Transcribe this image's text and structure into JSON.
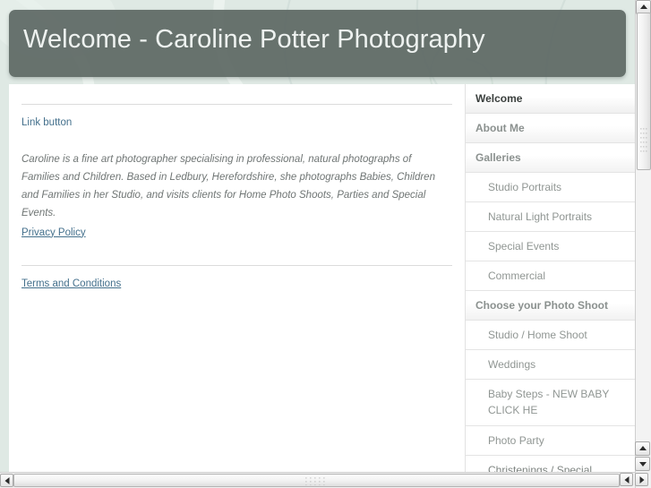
{
  "header": {
    "title": "Welcome - Caroline Potter Photography"
  },
  "content": {
    "link_button": "Link button",
    "intro_paragraph": "Caroline is a fine art photographer specialising in professional, natural photographs of Families and Children. Based in Ledbury, Herefordshire, she photographs Babies, Children and Families in her Studio, and visits clients for Home Photo Shoots, Parties and Special Events.",
    "privacy_policy": "Privacy Policy",
    "terms_and_conditions": "Terms and Conditions"
  },
  "sidebar": {
    "items": [
      {
        "label": "Welcome",
        "level": "top",
        "active": true
      },
      {
        "label": "About Me",
        "level": "top",
        "active": false
      },
      {
        "label": "Galleries",
        "level": "top",
        "active": false
      },
      {
        "label": "Studio Portraits",
        "level": "sub",
        "active": false
      },
      {
        "label": "Natural Light Portraits",
        "level": "sub",
        "active": false
      },
      {
        "label": "Special Events",
        "level": "sub",
        "active": false
      },
      {
        "label": "Commercial",
        "level": "sub",
        "active": false
      },
      {
        "label": "Choose your Photo Shoot",
        "level": "top",
        "active": false
      },
      {
        "label": "Studio / Home Shoot",
        "level": "sub",
        "active": false
      },
      {
        "label": "Weddings",
        "level": "sub",
        "active": false
      },
      {
        "label": "Baby Steps - NEW BABY CLICK HE",
        "level": "sub",
        "active": false,
        "two_line": true
      },
      {
        "label": "Photo Party",
        "level": "sub",
        "active": false
      },
      {
        "label": "Christenings / Special",
        "level": "sub",
        "active": false,
        "clipped": true
      }
    ]
  },
  "colors": {
    "page_background": "#dfe9e4",
    "header_banner": "#5e6864",
    "header_text": "#eef2f0",
    "link": "#44708c",
    "body_text": "#6f7574",
    "nav_top_text": "#8b918f",
    "nav_active_text": "#3a3f3d",
    "panel": "#ffffff"
  },
  "scrollbars": {
    "vertical": {
      "up_arrow": "scroll-up-icon",
      "down_arrow": "scroll-down-icon"
    },
    "horizontal": {
      "left_arrow": "scroll-left-icon",
      "right_arrow": "scroll-right-icon"
    }
  }
}
